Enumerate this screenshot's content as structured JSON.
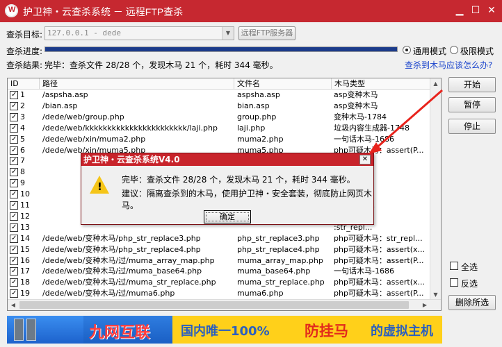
{
  "window": {
    "title": "护卫神・云查杀系统 － 远程FTP查杀",
    "minimize": "▁",
    "maximize": "☐",
    "close": "✕"
  },
  "scan_target": {
    "label": "查杀目标:",
    "value": "127.0.0.1 - dede",
    "remote_button": "远程FTP服务器"
  },
  "scan_progress": {
    "label": "查杀进度:",
    "progress": 1.0,
    "mode_normal": "通用模式",
    "mode_extreme": "极限模式",
    "selected_mode": "normal"
  },
  "scan_result": {
    "label": "查杀结果:",
    "text": "完毕：查杀文件 28/28 个，发现木马 21 个，耗时 344 毫秒。",
    "help_link": "查杀到木马应该怎么办?"
  },
  "table": {
    "columns": [
      "ID",
      "路径",
      "文件名",
      "木马类型"
    ],
    "rows": [
      {
        "id": "1",
        "path": "/aspsha.asp",
        "file": "aspsha.asp",
        "type": "asp变种木马",
        "checked": true
      },
      {
        "id": "2",
        "path": "/bian.asp",
        "file": "bian.asp",
        "type": "asp变种木马",
        "checked": true
      },
      {
        "id": "3",
        "path": "/dede/web/group.php",
        "file": "group.php",
        "type": "变种木马-1784",
        "checked": true
      },
      {
        "id": "4",
        "path": "/dede/web/kkkkkkkkkkkkkkkkkkkkkkk/laji.php",
        "file": "laji.php",
        "type": "垃圾内容生成器-1748",
        "checked": true
      },
      {
        "id": "5",
        "path": "/dede/web/xin/muma2.php",
        "file": "muma2.php",
        "type": "一句话木马-1686",
        "checked": true
      },
      {
        "id": "6",
        "path": "/dede/web/xin/muma5.php",
        "file": "muma5.php",
        "type": "php可疑木马：assert(P...",
        "checked": true
      },
      {
        "id": "7",
        "path": "",
        "file": "",
        "type": "",
        "checked": true
      },
      {
        "id": "8",
        "path": "",
        "file": "",
        "type": "-1517",
        "checked": true
      },
      {
        "id": "9",
        "path": "",
        "file": "",
        "type": "7",
        "checked": true
      },
      {
        "id": "10",
        "path": "",
        "file": "",
        "type": "",
        "checked": true
      },
      {
        "id": "11",
        "path": "",
        "file": "",
        "type": ":assert(p...",
        "checked": true
      },
      {
        "id": "12",
        "path": "",
        "file": "",
        "type": ":str_repl...",
        "checked": true
      },
      {
        "id": "13",
        "path": "",
        "file": "",
        "type": ":str_repl...",
        "checked": true
      },
      {
        "id": "14",
        "path": "/dede/web/变种木马/php_str_replace3.php",
        "file": "php_str_replace3.php",
        "type": "php可疑木马：str_repl...",
        "checked": true
      },
      {
        "id": "15",
        "path": "/dede/web/变种木马/php_str_replace4.php",
        "file": "php_str_replace4.php",
        "type": "php可疑木马：assert(x...",
        "checked": true
      },
      {
        "id": "16",
        "path": "/dede/web/变种木马/过/muma_array_map.php",
        "file": "muma_array_map.php",
        "type": "php可疑木马：assert(P...",
        "checked": true
      },
      {
        "id": "17",
        "path": "/dede/web/变种木马/过/muma_base64.php",
        "file": "muma_base64.php",
        "type": "一句话木马-1686",
        "checked": true
      },
      {
        "id": "18",
        "path": "/dede/web/变种木马/过/muma_str_replace.php",
        "file": "muma_str_replace.php",
        "type": "php可疑木马：assert(x...",
        "checked": true
      },
      {
        "id": "19",
        "path": "/dede/web/变种木马/过/muma6.php",
        "file": "muma6.php",
        "type": "php可疑木马：assert(P...",
        "checked": true
      }
    ]
  },
  "side": {
    "start": "开始",
    "pause": "暂停",
    "stop": "停止",
    "select_all": "全选",
    "invert": "反选",
    "delete_selected": "删除所选"
  },
  "dialog": {
    "title": "护卫神・云查杀系统V4.0",
    "close": "✕",
    "line1": "完毕：查杀文件 28/28 个，发现木马 21 个，耗时 344 毫秒。",
    "line2": "建议：隔离查杀到的木马，使用护卫神・安全套装，彻底防止网页木马。",
    "ok": "确定"
  },
  "banner": {
    "brand": "九网互联",
    "slogan1": "国内唯一100%",
    "slogan2": "防挂马",
    "slogan3": "的虚拟主机"
  },
  "colors": {
    "titlebar": "#c62830",
    "progress": "#1b3b8a",
    "link": "#1a44cc"
  }
}
